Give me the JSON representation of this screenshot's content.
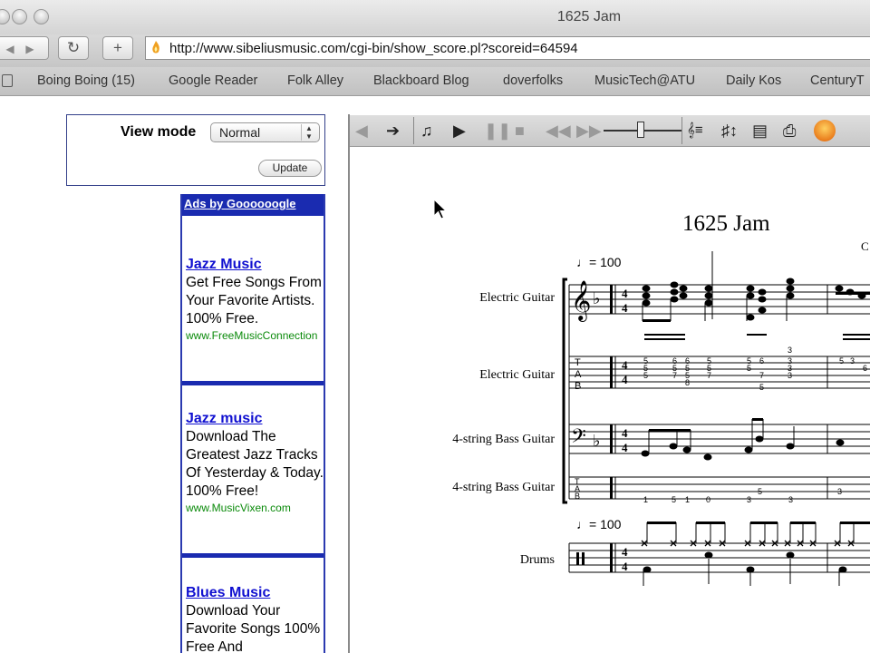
{
  "window": {
    "title": "1625 Jam"
  },
  "nav": {
    "back": "◀",
    "forward": "▶",
    "reload": "↻",
    "add": "+",
    "url": "http://www.sibeliusmusic.com/cgi-bin/show_score.pl?scoreid=64594"
  },
  "bookmarks": [
    "Boing Boing (15)",
    "Google Reader",
    "Folk Alley",
    "Blackboard Blog",
    "doverfolks",
    "MusicTech@ATU",
    "Daily Kos",
    "CenturyT"
  ],
  "view_panel": {
    "label": "View mode",
    "selected": "Normal",
    "update_label": "Update"
  },
  "ads": {
    "header": "Ads by Goooooogle",
    "items": [
      {
        "title": "Jazz Music",
        "body": "Get Free Songs From Your Favorite Artists. 100% Free.",
        "url": "www.FreeMusicConnection"
      },
      {
        "title": "Jazz music",
        "body": "Download The Greatest Jazz Tracks Of Yesterday & Today. 100% Free!",
        "url": "www.MusicVixen.com"
      },
      {
        "title": "Blues Music",
        "body": "Download Your Favorite Songs 100% Free And",
        "url": ""
      }
    ]
  },
  "score": {
    "title": "1625 Jam",
    "composer_fragment": "C",
    "tempo_marks": [
      "♩= 100",
      "♩= 100"
    ],
    "instruments": [
      "Electric Guitar",
      "Electric Guitar",
      "4-string Bass Guitar",
      "4-string Bass Guitar",
      "Drums"
    ],
    "tab_letters": [
      "T",
      "A",
      "B"
    ],
    "time_signature": {
      "top": "4",
      "bottom": "4"
    },
    "guitar_tab_numbers": [
      "5",
      "5",
      "5",
      "6",
      "5",
      "7",
      "6",
      "5",
      "5",
      "8",
      "5",
      "5",
      "7",
      "5",
      "6",
      "5",
      "7",
      "5",
      "3",
      "3",
      "3",
      "3",
      "5",
      "3",
      "6"
    ],
    "bass_tab_numbers": [
      "1",
      "5",
      "1",
      "0",
      "3",
      "5",
      "3",
      "3"
    ]
  },
  "colors": {
    "link": "#1010d0",
    "ad_border": "#1a2bb0",
    "ad_url": "#0a8a0a"
  }
}
